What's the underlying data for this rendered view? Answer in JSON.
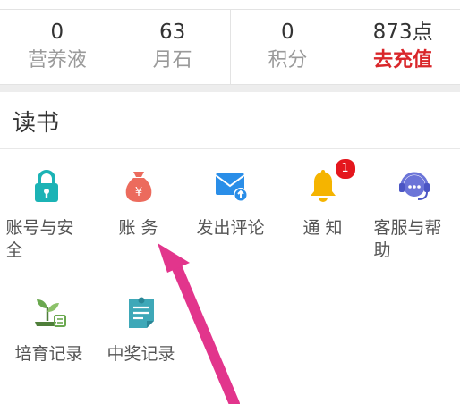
{
  "stats": [
    {
      "value": "0",
      "label": "营养液"
    },
    {
      "value": "63",
      "label": "月石"
    },
    {
      "value": "0",
      "label": "积分"
    },
    {
      "value": "873点",
      "label": "去充值"
    }
  ],
  "section": {
    "title": "读书",
    "items": [
      {
        "label": "账号与安全",
        "icon": "lock-icon"
      },
      {
        "label": "账 务",
        "icon": "money-bag-icon"
      },
      {
        "label": "发出评论",
        "icon": "mail-upload-icon"
      },
      {
        "label": "通 知",
        "icon": "bell-icon",
        "badge": "1"
      },
      {
        "label": "客服与帮助",
        "icon": "headset-icon"
      },
      {
        "label": "培育记录",
        "icon": "sprout-icon"
      },
      {
        "label": "中奖记录",
        "icon": "prize-note-icon"
      }
    ]
  },
  "colors": {
    "lock": "#1bb3b5",
    "money_bag": "#ec6b5d",
    "mail": "#2a8ee8",
    "bell": "#f5b400",
    "headset": "#6b74d8",
    "sprout": "#6aa84f",
    "prize_note": "#3ea8b8",
    "recharge": "#d9262a",
    "arrow": "#e2358c"
  }
}
